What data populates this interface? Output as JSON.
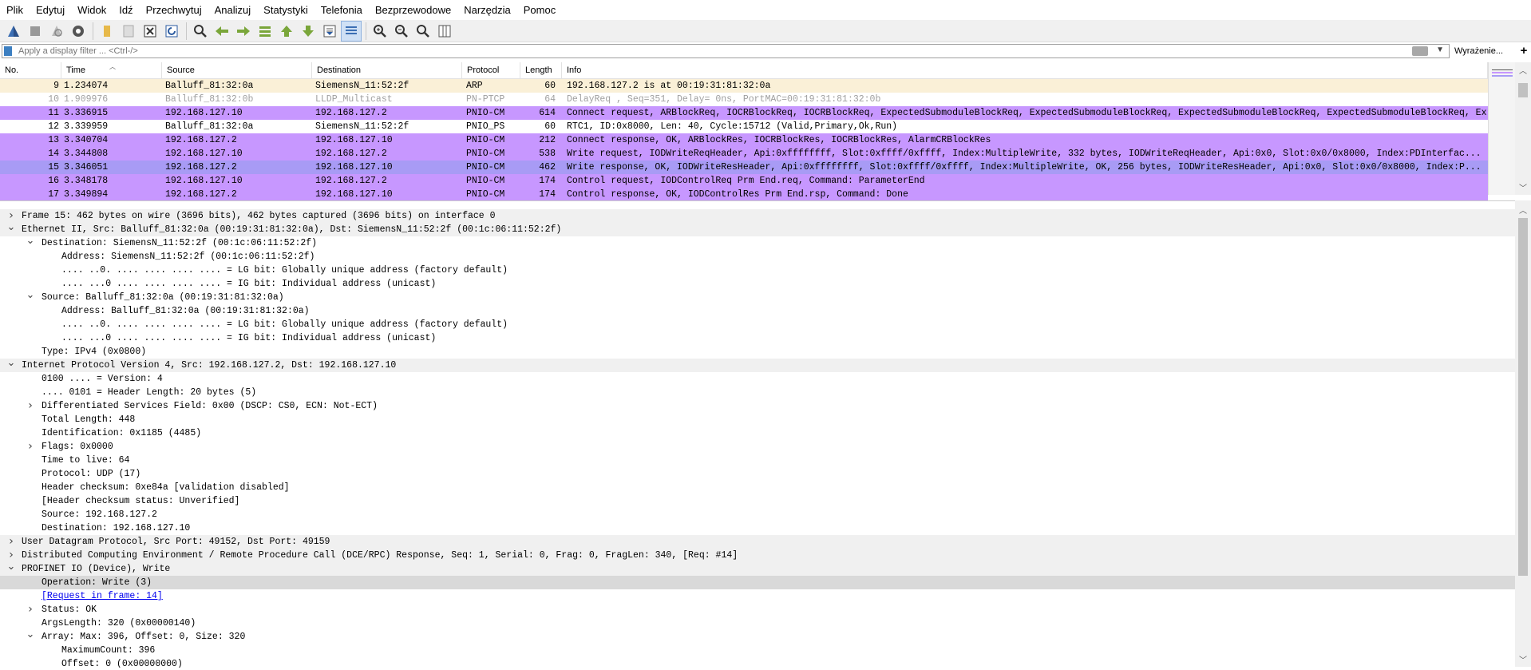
{
  "menu": [
    "Plik",
    "Edytuj",
    "Widok",
    "Idź",
    "Przechwytuj",
    "Analizuj",
    "Statystyki",
    "Telefonia",
    "Bezprzewodowe",
    "Narzędzia",
    "Pomoc"
  ],
  "filter": {
    "placeholder": "Apply a display filter ... <Ctrl-/>",
    "expression_label": "Wyrażenie...",
    "plus_label": "+"
  },
  "columns": [
    "No.",
    "Time",
    "Source",
    "Destination",
    "Protocol",
    "Length",
    "Info"
  ],
  "packets": [
    {
      "no": "9",
      "time": "1.234074",
      "src": "Balluff_81:32:0a",
      "dst": "SiemensN_11:52:2f",
      "proto": "ARP",
      "len": "60",
      "info": "192.168.127.2 is at 00:19:31:81:32:0a",
      "bg": "#faf0d7",
      "fg": "#000000"
    },
    {
      "no": "10",
      "time": "1.909976",
      "src": "Balluff_81:32:0b",
      "dst": "LLDP_Multicast",
      "proto": "PN-PTCP",
      "len": "64",
      "info": "DelayReq         , Seq=351, Delay=         0ns, PortMAC=00:19:31:81:32:0b",
      "bg": "#ffffff",
      "fg": "#a0a0a0"
    },
    {
      "no": "11",
      "time": "3.336915",
      "src": "192.168.127.10",
      "dst": "192.168.127.2",
      "proto": "PNIO-CM",
      "len": "614",
      "info": "Connect request, ARBlockReq, IOCRBlockReq, IOCRBlockReq, ExpectedSubmoduleBlockReq, ExpectedSubmoduleBlockReq, ExpectedSubmoduleBlockReq, ExpectedSubmoduleBlockReq, Ex",
      "bg": "#c797ff",
      "fg": "#000000"
    },
    {
      "no": "12",
      "time": "3.339959",
      "src": "Balluff_81:32:0a",
      "dst": "SiemensN_11:52:2f",
      "proto": "PNIO_PS",
      "len": "60",
      "info": "RTC1, ID:0x8000, Len:  40, Cycle:15712 (Valid,Primary,Ok,Run)",
      "bg": "#ffffff",
      "fg": "#000000"
    },
    {
      "no": "13",
      "time": "3.340704",
      "src": "192.168.127.2",
      "dst": "192.168.127.10",
      "proto": "PNIO-CM",
      "len": "212",
      "info": "Connect response, OK, ARBlockRes, IOCRBlockRes, IOCRBlockRes, AlarmCRBlockRes",
      "bg": "#c797ff",
      "fg": "#000000"
    },
    {
      "no": "14",
      "time": "3.344808",
      "src": "192.168.127.10",
      "dst": "192.168.127.2",
      "proto": "PNIO-CM",
      "len": "538",
      "info": "Write request, IODWriteReqHeader, Api:0xffffffff, Slot:0xffff/0xffff, Index:MultipleWrite, 332 bytes, IODWriteReqHeader, Api:0x0, Slot:0x0/0x8000, Index:PDInterfac...",
      "bg": "#c797ff",
      "fg": "#000000"
    },
    {
      "no": "15",
      "time": "3.346051",
      "src": "192.168.127.2",
      "dst": "192.168.127.10",
      "proto": "PNIO-CM",
      "len": "462",
      "info": "Write response, OK, IODWriteResHeader, Api:0xffffffff, Slot:0xffff/0xffff, Index:MultipleWrite, OK, 256 bytes, IODWriteResHeader, Api:0x0, Slot:0x0/0x8000, Index:P...",
      "bg": "#a89bf5",
      "fg": "#000000"
    },
    {
      "no": "16",
      "time": "3.348178",
      "src": "192.168.127.10",
      "dst": "192.168.127.2",
      "proto": "PNIO-CM",
      "len": "174",
      "info": "Control request, IODControlReq Prm End.req, Command: ParameterEnd",
      "bg": "#c797ff",
      "fg": "#000000"
    },
    {
      "no": "17",
      "time": "3.349894",
      "src": "192.168.127.2",
      "dst": "192.168.127.10",
      "proto": "PNIO-CM",
      "len": "174",
      "info": "Control response, OK, IODControlRes Prm End.rsp, Command: Done",
      "bg": "#c797ff",
      "fg": "#000000"
    }
  ],
  "details": [
    {
      "level": 0,
      "exp": "closed",
      "text": "Frame 15: 462 bytes on wire (3696 bits), 462 bytes captured (3696 bits) on interface 0"
    },
    {
      "level": 0,
      "exp": "open",
      "text": "Ethernet II, Src: Balluff_81:32:0a (00:19:31:81:32:0a), Dst: SiemensN_11:52:2f (00:1c:06:11:52:2f)"
    },
    {
      "level": 1,
      "exp": "open",
      "text": "Destination: SiemensN_11:52:2f (00:1c:06:11:52:2f)"
    },
    {
      "level": 2,
      "exp": "none",
      "text": "Address: SiemensN_11:52:2f (00:1c:06:11:52:2f)"
    },
    {
      "level": 2,
      "exp": "none",
      "text": ".... ..0. .... .... .... .... = LG bit: Globally unique address (factory default)"
    },
    {
      "level": 2,
      "exp": "none",
      "text": ".... ...0 .... .... .... .... = IG bit: Individual address (unicast)"
    },
    {
      "level": 1,
      "exp": "open",
      "text": "Source: Balluff_81:32:0a (00:19:31:81:32:0a)"
    },
    {
      "level": 2,
      "exp": "none",
      "text": "Address: Balluff_81:32:0a (00:19:31:81:32:0a)"
    },
    {
      "level": 2,
      "exp": "none",
      "text": ".... ..0. .... .... .... .... = LG bit: Globally unique address (factory default)"
    },
    {
      "level": 2,
      "exp": "none",
      "text": ".... ...0 .... .... .... .... = IG bit: Individual address (unicast)"
    },
    {
      "level": 1,
      "exp": "none",
      "text": "Type: IPv4 (0x0800)"
    },
    {
      "level": 0,
      "exp": "open",
      "text": "Internet Protocol Version 4, Src: 192.168.127.2, Dst: 192.168.127.10"
    },
    {
      "level": 1,
      "exp": "none",
      "text": "0100 .... = Version: 4"
    },
    {
      "level": 1,
      "exp": "none",
      "text": ".... 0101 = Header Length: 20 bytes (5)"
    },
    {
      "level": 1,
      "exp": "closed",
      "text": "Differentiated Services Field: 0x00 (DSCP: CS0, ECN: Not-ECT)"
    },
    {
      "level": 1,
      "exp": "none",
      "text": "Total Length: 448"
    },
    {
      "level": 1,
      "exp": "none",
      "text": "Identification: 0x1185 (4485)"
    },
    {
      "level": 1,
      "exp": "closed",
      "text": "Flags: 0x0000"
    },
    {
      "level": 1,
      "exp": "none",
      "text": "Time to live: 64"
    },
    {
      "level": 1,
      "exp": "none",
      "text": "Protocol: UDP (17)"
    },
    {
      "level": 1,
      "exp": "none",
      "text": "Header checksum: 0xe84a [validation disabled]"
    },
    {
      "level": 1,
      "exp": "none",
      "text": "[Header checksum status: Unverified]"
    },
    {
      "level": 1,
      "exp": "none",
      "text": "Source: 192.168.127.2"
    },
    {
      "level": 1,
      "exp": "none",
      "text": "Destination: 192.168.127.10"
    },
    {
      "level": 0,
      "exp": "closed",
      "text": "User Datagram Protocol, Src Port: 49152, Dst Port: 49159"
    },
    {
      "level": 0,
      "exp": "closed",
      "text": "Distributed Computing Environment / Remote Procedure Call (DCE/RPC) Response, Seq: 1, Serial: 0, Frag: 0, FragLen: 340, [Req: #14]"
    },
    {
      "level": 0,
      "exp": "open",
      "text": "PROFINET IO (Device), Write"
    },
    {
      "level": 1,
      "exp": "none",
      "text": "Operation: Write (3)",
      "selected": true
    },
    {
      "level": 1,
      "exp": "none",
      "text": "[Request in frame: 14]",
      "link": true
    },
    {
      "level": 1,
      "exp": "closed",
      "text": "Status: OK"
    },
    {
      "level": 1,
      "exp": "none",
      "text": "ArgsLength: 320 (0x00000140)"
    },
    {
      "level": 1,
      "exp": "open",
      "text": "Array: Max: 396, Offset: 0, Size: 320"
    },
    {
      "level": 2,
      "exp": "none",
      "text": "MaximumCount: 396"
    },
    {
      "level": 2,
      "exp": "none",
      "text": "Offset: 0 (0x00000000)"
    }
  ]
}
